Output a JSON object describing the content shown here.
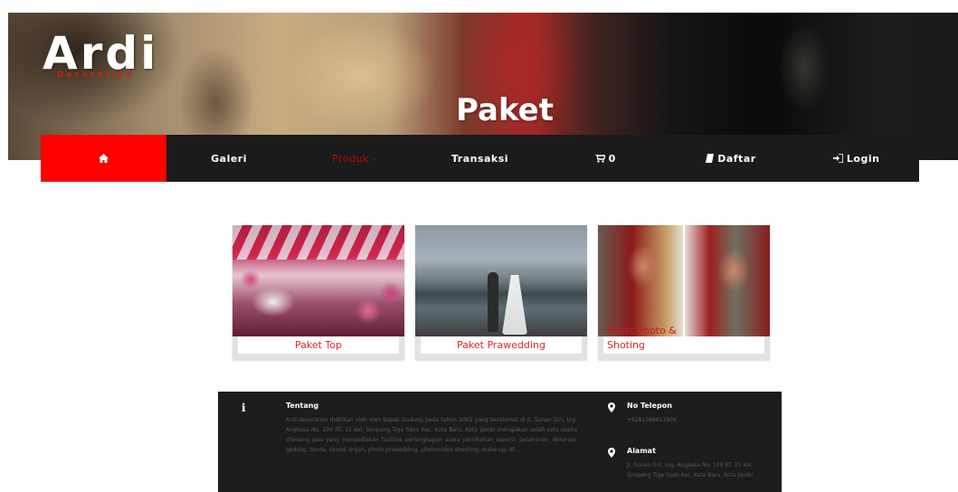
{
  "brand": {
    "logo": "Ardi",
    "logo_sub": "Decoration"
  },
  "hero": {
    "title": "Paket"
  },
  "nav": {
    "home_icon": "home-icon",
    "items": [
      {
        "label": "Galeri"
      },
      {
        "label": "Produk -"
      },
      {
        "label": "Transaksi"
      },
      {
        "label": "0",
        "icon": "cart-icon"
      },
      {
        "label": "Daftar",
        "icon": "book-icon"
      },
      {
        "label": "Login",
        "icon": "sign-in-icon"
      }
    ]
  },
  "cards": [
    {
      "label": "Paket Top"
    },
    {
      "label": "Paket Prawedding"
    },
    {
      "label": "Shoting",
      "overlay": "Paket Photo &"
    }
  ],
  "footer": {
    "about": {
      "icon": "info-icon",
      "heading": "Tentang",
      "text": "Ardi decoration didirikan oleh oleh bapak Dudung pada tahun 2001 yang beralamat di Jl. Sunan Giri, Lrg. Angkasa No. 100 RT. 15 Kel. Simpang Tiga Sipin Kec. Kota Baru, Kota Jambi merupakan salah satu usaha dibidang jasa yang menyediakan fasilitas perlengkapan acara pernikahan seperti: pelaminan, dekorasi, gedung, tenda, sound, organ, photo prewedding, photo/video shooting, make up, dll."
    },
    "phone": {
      "icon": "map-marker-icon",
      "heading": "No Telepon",
      "text": "+6281366813909"
    },
    "address": {
      "icon": "map-marker-icon",
      "heading": "Alamat",
      "text": "Jl. Sunan Giri, Lrg. Angkasa No. 100 RT. 15 Kel. Simpang Tiga Sipin Kec. Kota Baru, Kota Jambi"
    }
  }
}
